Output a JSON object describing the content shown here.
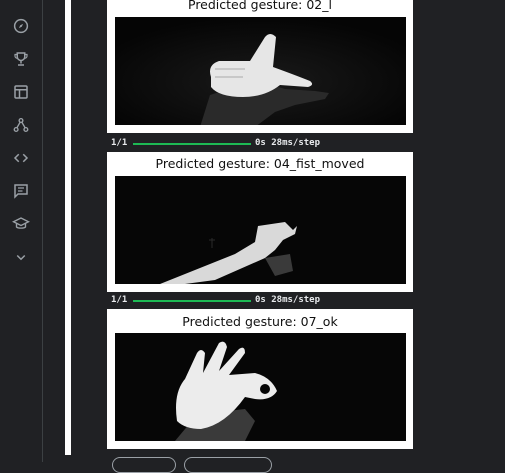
{
  "sidebar": {
    "items": [
      {
        "name": "compass-icon"
      },
      {
        "name": "trophy-icon"
      },
      {
        "name": "table-icon"
      },
      {
        "name": "model-icon"
      },
      {
        "name": "code-icon"
      },
      {
        "name": "discussion-icon"
      },
      {
        "name": "learn-icon"
      },
      {
        "name": "expand-more-icon"
      }
    ]
  },
  "outputs": [
    {
      "title": "Predicted gesture: 02_l"
    },
    {
      "title": "Predicted gesture: 04_fist_moved"
    },
    {
      "title": "Predicted gesture: 07_ok"
    }
  ],
  "progress": [
    {
      "count": "1/1",
      "timing": "0s 28ms/step",
      "fraction": 1.0
    },
    {
      "count": "1/1",
      "timing": "0s 28ms/step",
      "fraction": 1.0
    }
  ],
  "colors": {
    "background": "#202124",
    "progress_fill": "#1db954",
    "icon": "#9aa0a6"
  }
}
